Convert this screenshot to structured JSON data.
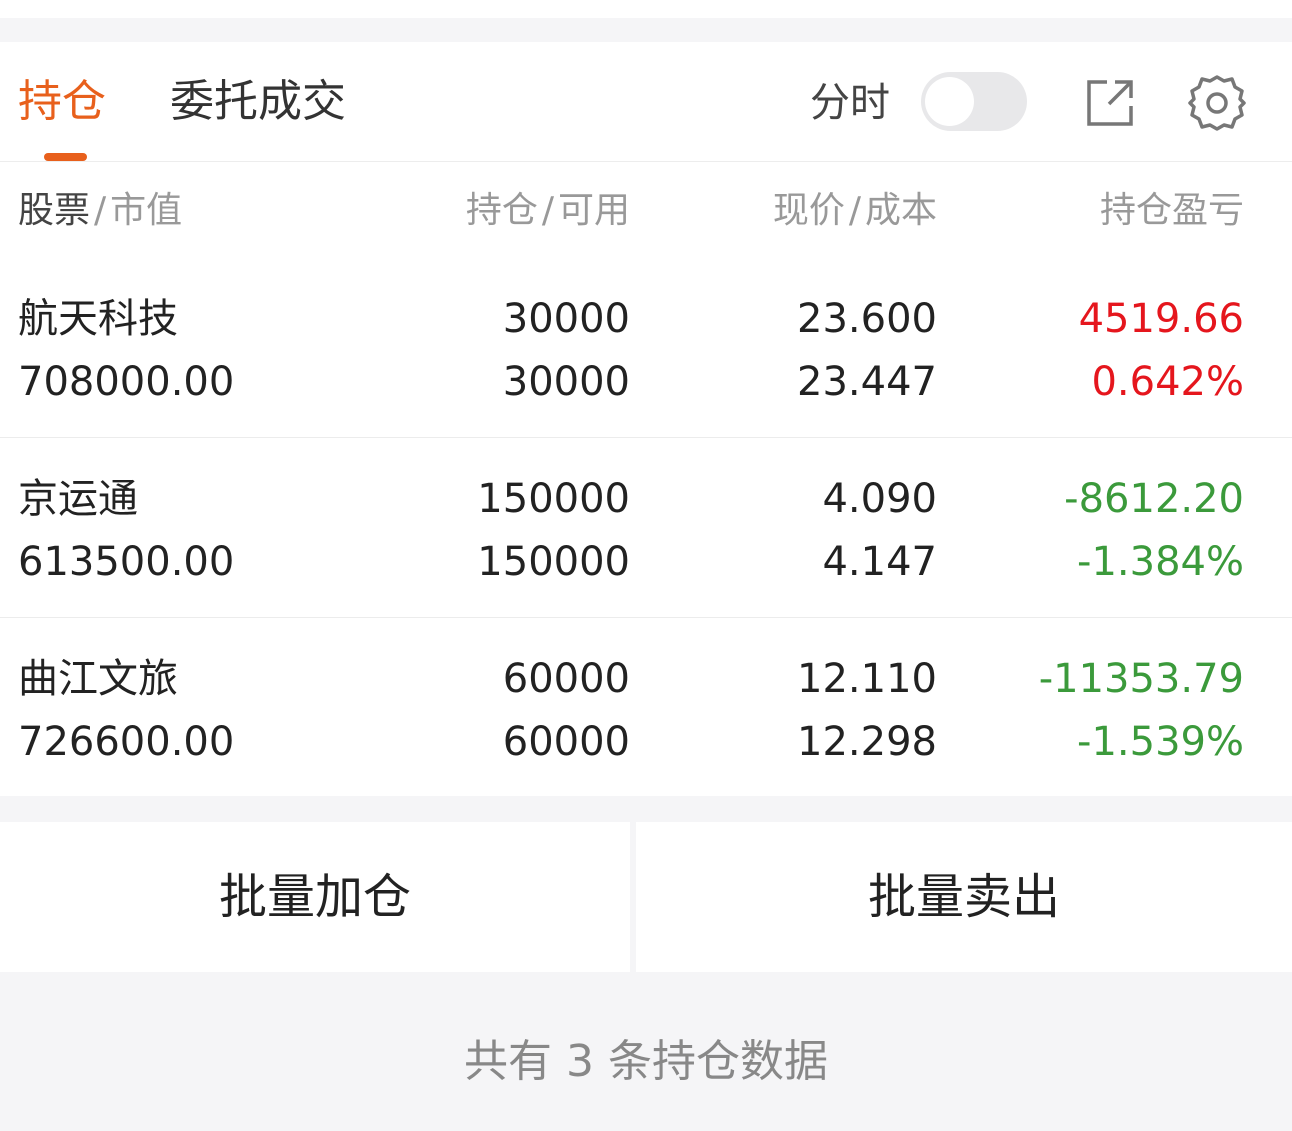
{
  "tabs": {
    "holdings": "持仓",
    "orders": "委托成交"
  },
  "toolbar": {
    "timeshare_label": "分时",
    "timeshare_on": false,
    "external_icon": "external-link-icon",
    "settings_icon": "gear-icon"
  },
  "columns": {
    "stock": "股票",
    "market_value": "市值",
    "position": "持仓",
    "available": "可用",
    "price": "现价",
    "cost": "成本",
    "pl": "持仓盈亏"
  },
  "colors": {
    "accent": "#e8601c",
    "profit": "#e5161d",
    "loss": "#3b9a3b"
  },
  "positions": [
    {
      "name": "航天科技",
      "market_value": "708000.00",
      "position": "30000",
      "available": "30000",
      "price": "23.600",
      "cost": "23.447",
      "pl": "4519.66",
      "pl_pct": "0.642%",
      "trend": "pos"
    },
    {
      "name": "京运通",
      "market_value": "613500.00",
      "position": "150000",
      "available": "150000",
      "price": "4.090",
      "cost": "4.147",
      "pl": "-8612.20",
      "pl_pct": "-1.384%",
      "trend": "neg"
    },
    {
      "name": "曲江文旅",
      "market_value": "726600.00",
      "position": "60000",
      "available": "60000",
      "price": "12.110",
      "cost": "12.298",
      "pl": "-11353.79",
      "pl_pct": "-1.539%",
      "trend": "neg"
    }
  ],
  "actions": {
    "batch_add": "批量加仓",
    "batch_sell": "批量卖出"
  },
  "footer": {
    "summary": "共有 3 条持仓数据"
  }
}
